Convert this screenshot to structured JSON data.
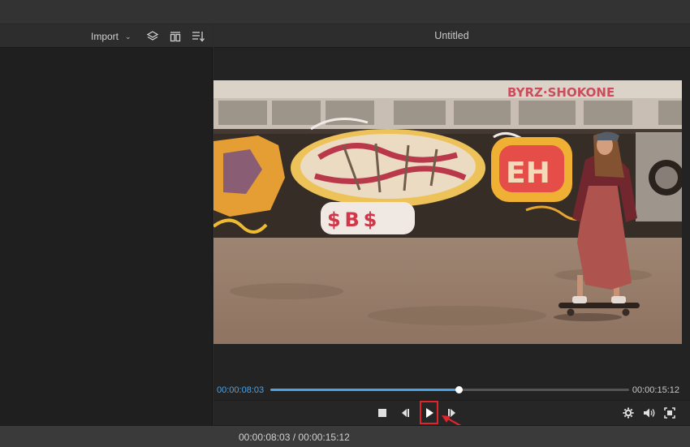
{
  "media_panel": {
    "import_label": "Import",
    "import_dropdown_icon": "chevron-down-icon",
    "tools": [
      "layers-icon",
      "columns-icon",
      "sort-list-icon"
    ]
  },
  "preview": {
    "title": "Untitled",
    "current_time": "00:00:08:03",
    "total_time": "00:00:15:12",
    "progress": 0.525,
    "controls": {
      "left": [
        "stop-icon",
        "step-back-icon",
        "play-icon",
        "step-forward-icon"
      ],
      "right": [
        "settings-icon",
        "volume-icon",
        "fullscreen-icon"
      ]
    }
  },
  "status_bar": {
    "timecode": "00:00:08:03 / 00:00:15:12"
  },
  "colors": {
    "accent": "#4aa3e8",
    "highlight": "#e0242b",
    "panel_bg": "#1f1f1f"
  }
}
